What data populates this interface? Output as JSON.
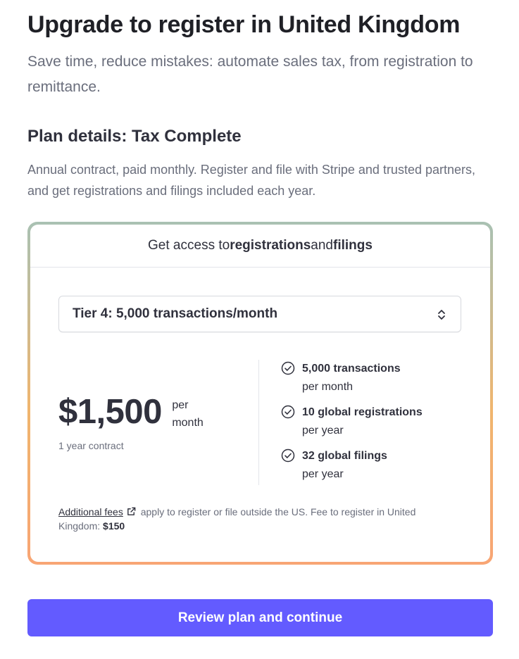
{
  "header": {
    "title": "Upgrade to register in United Kingdom",
    "subtitle": "Save time, reduce mistakes: automate sales tax, from registration to remittance."
  },
  "plan": {
    "title": "Plan details: Tax Complete",
    "description": "Annual contract, paid monthly. Register and file with Stripe and trusted partners, and get registrations and filings included each year."
  },
  "card": {
    "header_prefix": "Get access to ",
    "header_bold_1": "registrations",
    "header_mid": " and ",
    "header_bold_2": "filings",
    "tier_select": {
      "selected": "Tier 4: 5,000 transactions/month",
      "icon": "chevron-up-down-icon"
    },
    "price": "$1,500",
    "per_line_1": "per",
    "per_line_2": "month",
    "contract": "1 year contract",
    "features": [
      {
        "main": "5,000 transactions",
        "sub": "per month",
        "icon": "check-circle-icon"
      },
      {
        "main": "10 global registrations",
        "sub": "per year",
        "icon": "check-circle-icon"
      },
      {
        "main": "32 global filings",
        "sub": "per year",
        "icon": "check-circle-icon"
      }
    ],
    "fees": {
      "link": "Additional fees",
      "link_icon": "external-link-icon",
      "text": "apply to register or file outside the US. Fee to register in United Kingdom:",
      "amount": "$150"
    }
  },
  "cta": {
    "label": "Review plan and continue"
  },
  "colors": {
    "accent": "#635bff",
    "card_gradient_top": "#a9c1b3",
    "card_gradient_bottom": "#f8a574"
  }
}
